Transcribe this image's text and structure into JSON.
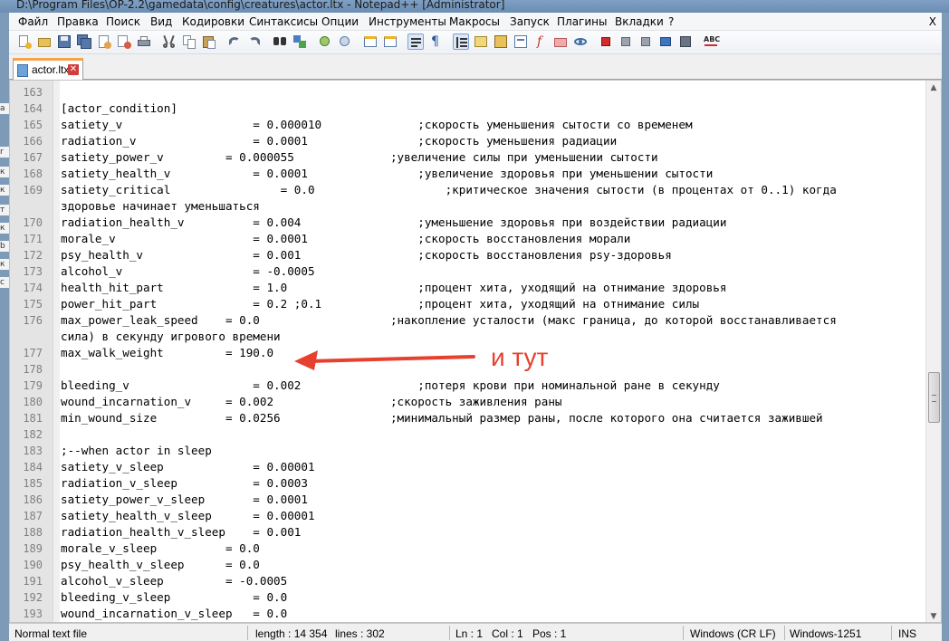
{
  "window_title": "D:\\Program Files\\OP-2.2\\gamedata\\config\\creatures\\actor.ltx - Notepad++ [Administrator]",
  "menu": [
    "Файл",
    "Правка",
    "Поиск",
    "Вид",
    "Кодировки",
    "Синтаксисы",
    "Опции",
    "Инструменты",
    "Макросы",
    "Запуск",
    "Плагины",
    "Вкладки",
    "?"
  ],
  "menu_close": "X",
  "tab": {
    "label": "actor.ltx",
    "close": "✕"
  },
  "left_strip_fragments": [
    "a",
    "r",
    "к",
    "к",
    "т",
    "к",
    "b",
    "к",
    "с"
  ],
  "lines": [
    {
      "n": "163",
      "text": ""
    },
    {
      "n": "164",
      "text": "[actor_condition]"
    },
    {
      "n": "165",
      "text": "satiety_v                   = 0.000010              ;скорость уменьшения сытости со временем"
    },
    {
      "n": "166",
      "text": "radiation_v                 = 0.0001                ;скорость уменьшения радиации"
    },
    {
      "n": "167",
      "text": "satiety_power_v         = 0.000055              ;увеличение силы при уменьшении сытости"
    },
    {
      "n": "168",
      "text": "satiety_health_v            = 0.0001                ;увеличение здоровья при уменьшении сытости"
    },
    {
      "n": "169",
      "text": "satiety_critical                = 0.0                   ;критическое значения сытости (в процентах от 0..1) когда"
    },
    {
      "n": "",
      "text": "здоровье начинает уменьшаться"
    },
    {
      "n": "170",
      "text": "radiation_health_v          = 0.004                 ;уменьшение здоровья при воздействии радиации"
    },
    {
      "n": "171",
      "text": "morale_v                    = 0.0001                ;скорость восстановления морали"
    },
    {
      "n": "172",
      "text": "psy_health_v                = 0.001                 ;скорость восстановления psy-здоровья"
    },
    {
      "n": "173",
      "text": "alcohol_v                   = -0.0005"
    },
    {
      "n": "174",
      "text": "health_hit_part             = 1.0                   ;процент хита, уходящий на отнимание здоровья"
    },
    {
      "n": "175",
      "text": "power_hit_part              = 0.2 ;0.1              ;процент хита, уходящий на отнимание силы"
    },
    {
      "n": "176",
      "text": "max_power_leak_speed    = 0.0                   ;накопление усталости (макс граница, до которой восстанавливается"
    },
    {
      "n": "",
      "text": "сила) в секунду игрового времени"
    },
    {
      "n": "177",
      "text": "max_walk_weight         = 190.0"
    },
    {
      "n": "178",
      "text": ""
    },
    {
      "n": "179",
      "text": "bleeding_v                  = 0.002                 ;потеря крови при номинальной ране в секунду"
    },
    {
      "n": "180",
      "text": "wound_incarnation_v     = 0.002                 ;скорость заживления раны"
    },
    {
      "n": "181",
      "text": "min_wound_size          = 0.0256                ;минимальный размер раны, после которого она считается зажившей"
    },
    {
      "n": "182",
      "text": ""
    },
    {
      "n": "183",
      "text": ";--when actor in sleep"
    },
    {
      "n": "184",
      "text": "satiety_v_sleep             = 0.00001"
    },
    {
      "n": "185",
      "text": "radiation_v_sleep           = 0.0003"
    },
    {
      "n": "186",
      "text": "satiety_power_v_sleep       = 0.0001"
    },
    {
      "n": "187",
      "text": "satiety_health_v_sleep      = 0.00001"
    },
    {
      "n": "188",
      "text": "radiation_health_v_sleep    = 0.001"
    },
    {
      "n": "189",
      "text": "morale_v_sleep          = 0.0"
    },
    {
      "n": "190",
      "text": "psy_health_v_sleep      = 0.0"
    },
    {
      "n": "191",
      "text": "alcohol_v_sleep         = -0.0005"
    },
    {
      "n": "192",
      "text": "bleeding_v_sleep            = 0.0"
    },
    {
      "n": "193",
      "text": "wound_incarnation_v_sleep   = 0.0"
    }
  ],
  "annotation": {
    "text": "и тут",
    "color": "#e5412e"
  },
  "status": {
    "doc_type": "Normal text file",
    "length": "length : 14 354",
    "lines": "lines : 302",
    "ln": "Ln : 1",
    "col": "Col : 1",
    "pos": "Pos : 1",
    "eol": "Windows (CR LF)",
    "encoding": "Windows-1251",
    "mode": "INS"
  },
  "accent_colors": {
    "tab_top": "#f6a34b",
    "arrow": "#e5412e"
  }
}
